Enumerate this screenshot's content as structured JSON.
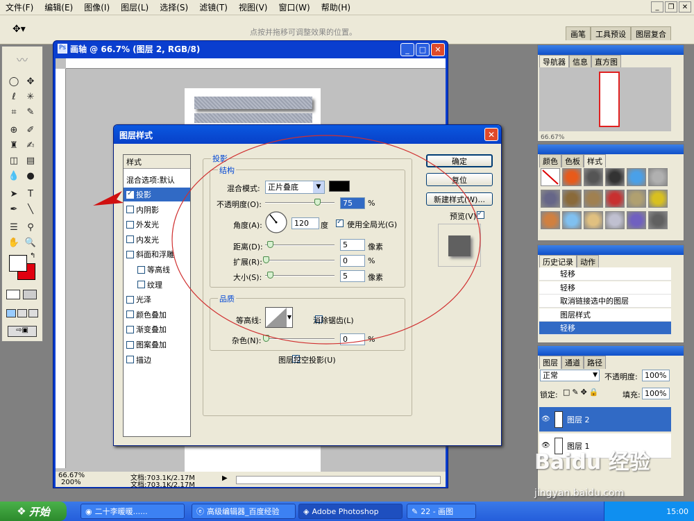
{
  "menubar": {
    "items": [
      "文件(F)",
      "编辑(E)",
      "图像(I)",
      "图层(L)",
      "选择(S)",
      "滤镜(T)",
      "视图(V)",
      "窗口(W)",
      "帮助(H)"
    ]
  },
  "options_bar": {
    "hint": "点按并拖移可调整效果的位置。",
    "palette_well": [
      "画笔",
      "工具预设",
      "图层复合"
    ]
  },
  "document": {
    "title": "画轴 @ 66.7% (图层 2, RGB/8)",
    "status_zoom_1": "66.67%",
    "status_doc_1": "文档:703.1K/2.17M",
    "status_zoom_2": "200%",
    "status_doc_2": "文档:703.1K/2.17M"
  },
  "dialog": {
    "title": "图层样式",
    "styles_header": "样式",
    "blend_options": "混合选项:默认",
    "styles": [
      {
        "label": "投影",
        "checked": true,
        "selected": true
      },
      {
        "label": "内阴影",
        "checked": false
      },
      {
        "label": "外发光",
        "checked": false
      },
      {
        "label": "内发光",
        "checked": false
      },
      {
        "label": "斜面和浮雕",
        "checked": false
      },
      {
        "label": "等高线",
        "checked": false
      },
      {
        "label": "纹理",
        "checked": false
      },
      {
        "label": "光泽",
        "checked": false
      },
      {
        "label": "颜色叠加",
        "checked": false
      },
      {
        "label": "渐变叠加",
        "checked": false
      },
      {
        "label": "图案叠加",
        "checked": false
      },
      {
        "label": "描边",
        "checked": false
      }
    ],
    "section_title": "投影",
    "structure_title": "结构",
    "blend_mode_label": "混合模式:",
    "blend_mode_label_key": "(B)",
    "blend_mode_value": "正片叠底",
    "shadow_color": "#000000",
    "opacity_label": "不透明度(O):",
    "opacity_value": "75",
    "percent": "%",
    "angle_label": "角度(A):",
    "angle_value": "120",
    "degree": "度",
    "global_light_label": "使用全局光(G)",
    "global_light_checked": true,
    "distance_label": "距离(D):",
    "distance_value": "5",
    "pixels": "像素",
    "spread_label": "扩展(R):",
    "spread_value": "0",
    "size_label": "大小(S):",
    "size_value": "5",
    "quality_title": "品质",
    "contour_label": "等高线:",
    "antialias_label": "消除锯齿(L)",
    "antialias_checked": false,
    "noise_label": "杂色(N):",
    "noise_value": "0",
    "knockout_label": "图层挖空投影(U)",
    "knockout_checked": true,
    "ok_label": "确定",
    "reset_label": "复位",
    "new_style_label": "新建样式(W)...",
    "preview_label": "预览(V)",
    "preview_checked": true
  },
  "navigator": {
    "tabs": [
      "导航器",
      "信息",
      "直方图"
    ],
    "zoom": "66.67%"
  },
  "styles_panel": {
    "tabs": [
      "颜色",
      "色板",
      "样式"
    ],
    "swatch_colors": [
      "#ffffff",
      "#e85a1a",
      "#555555",
      "#333333",
      "#4aa0e8",
      "#b0b0b0",
      "#666688",
      "#8a6a3a",
      "#a08050",
      "#c83030",
      "#b0a070",
      "#d8c020",
      "#d08040",
      "#80c0f0",
      "#e0c080",
      "#c0c0d0",
      "#7060c0",
      "#606060"
    ]
  },
  "history": {
    "tabs": [
      "历史记录",
      "动作"
    ],
    "rows": [
      "轻移",
      "轻移",
      "取消链接选中的图层",
      "图层样式",
      "轻移"
    ]
  },
  "layers": {
    "tabs": [
      "图层",
      "通道",
      "路径"
    ],
    "blend_mode": "正常",
    "opacity_label": "不透明度:",
    "opacity": "100%",
    "lock_label": "锁定:",
    "fill_label": "填充:",
    "fill": "100%",
    "rows": [
      "图层 2",
      "图层 1"
    ]
  },
  "taskbar": {
    "start": "开始",
    "tasks": [
      "二十李暖暖......",
      "高级编辑器_百度经验",
      "Adobe Photoshop",
      "22 - 画图"
    ],
    "clock": "15:00"
  },
  "watermark": {
    "brand": "Baidu 经验",
    "url": "jingyan.baidu.com"
  }
}
